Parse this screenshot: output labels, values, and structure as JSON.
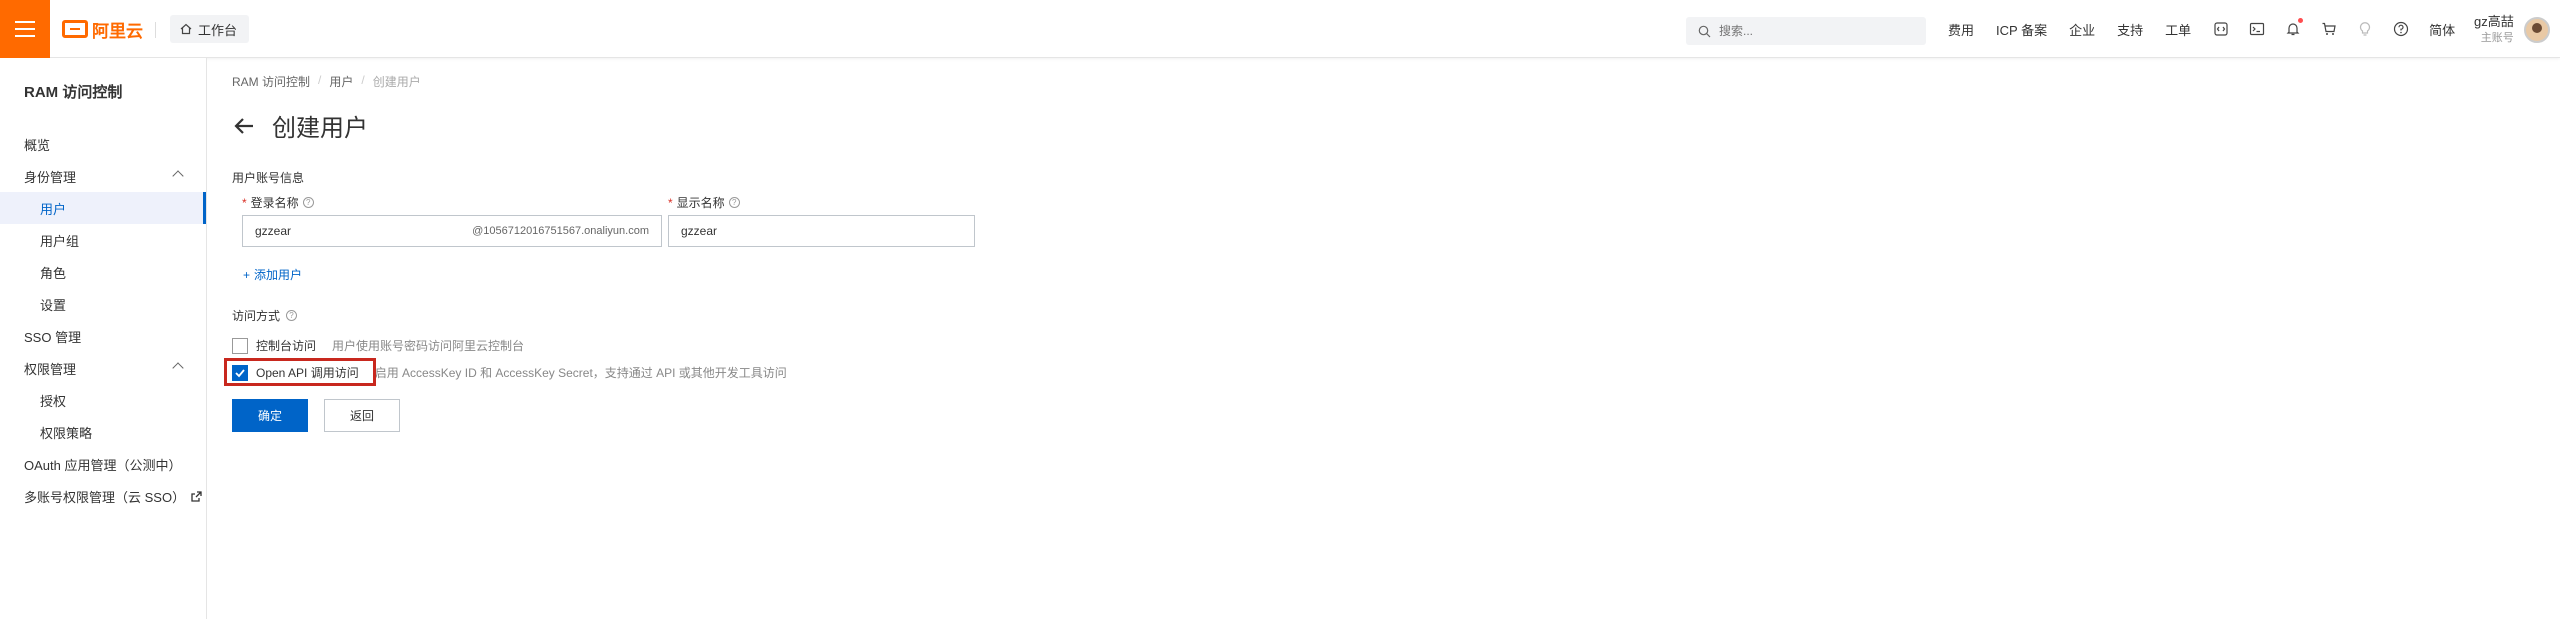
{
  "topbar": {
    "brand": "阿里云",
    "workbench": "工作台",
    "search_placeholder": "搜索...",
    "nav": [
      "费用",
      "ICP 备案",
      "企业",
      "支持",
      "工单"
    ],
    "lang": "简体",
    "user_name": "gz高喆",
    "user_role": "主账号",
    "accent": "#ff6a00"
  },
  "sidebar": {
    "title": "RAM 访问控制",
    "items": [
      {
        "label": "概览"
      },
      {
        "label": "身份管理"
      },
      {
        "label": "用户"
      },
      {
        "label": "用户组"
      },
      {
        "label": "角色"
      },
      {
        "label": "设置"
      },
      {
        "label": "SSO 管理"
      },
      {
        "label": "权限管理"
      },
      {
        "label": "授权"
      },
      {
        "label": "权限策略"
      },
      {
        "label": "OAuth 应用管理（公测中）"
      },
      {
        "label": "多账号权限管理（云 SSO）"
      }
    ]
  },
  "breadcrumb": [
    "RAM 访问控制",
    "用户",
    "创建用户"
  ],
  "page_title": "创建用户",
  "form": {
    "account_section": "用户账号信息",
    "login_label": "登录名称",
    "login_value": "gzzear",
    "login_suffix": "@1056712016751567.onaliyun.com",
    "display_label": "显示名称",
    "display_value": "gzzear",
    "add_user": "添加用户",
    "access_section": "访问方式",
    "console_label": "控制台访问",
    "console_desc": "用户使用账号密码访问阿里云控制台",
    "api_label": "Open API 调用访问",
    "api_desc": "启用 AccessKey ID 和 AccessKey Secret，支持通过 API 或其他开发工具访问",
    "confirm": "确定",
    "back": "返回"
  },
  "colors": {
    "primary": "#0064c8",
    "highlight": "#c8281e"
  }
}
